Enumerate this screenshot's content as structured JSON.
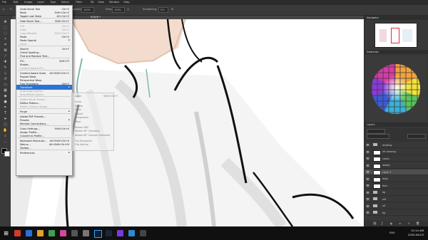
{
  "menubar": [
    "File",
    "Edit",
    "Image",
    "Layer",
    "Type",
    "Select",
    "Filter",
    "3D",
    "View",
    "Window",
    "Help"
  ],
  "options": {
    "size": "70",
    "mode_label": "Mode:",
    "mode": "Normal",
    "opacity_label": "Opacity:",
    "opacity": "100%",
    "flow_label": "Flow:",
    "flow": "100%",
    "smoothing_label": "Smoothing:",
    "smoothing": "0%"
  },
  "doc_tab": "RGB/8 *",
  "edit_menu": [
    {
      "label": "Undo Brush Tool",
      "shortcut": "Ctrl+Z",
      "state": "normal"
    },
    {
      "label": "Redo",
      "shortcut": "Shift+Ctrl+Z",
      "state": "normal"
    },
    {
      "label": "Toggle Last State",
      "shortcut": "Alt+Ctrl+Z",
      "state": "normal"
    },
    {
      "sep": true
    },
    {
      "label": "Fade Brush Tool...",
      "shortcut": "Shift+Ctrl+F",
      "state": "normal"
    },
    {
      "sep": true
    },
    {
      "label": "Cut",
      "shortcut": "Ctrl+X",
      "state": "disabled"
    },
    {
      "label": "Copy",
      "shortcut": "Ctrl+C",
      "state": "disabled"
    },
    {
      "label": "Copy Merged",
      "shortcut": "Shift+Ctrl+C",
      "state": "disabled"
    },
    {
      "label": "Paste",
      "shortcut": "Ctrl+V",
      "state": "normal"
    },
    {
      "label": "Paste Special",
      "submenu": true,
      "state": "normal"
    },
    {
      "label": "Clear",
      "state": "disabled"
    },
    {
      "sep": true
    },
    {
      "label": "Search",
      "shortcut": "Ctrl+F",
      "state": "normal"
    },
    {
      "label": "Check Spelling...",
      "state": "normal"
    },
    {
      "label": "Find and Replace Text...",
      "state": "normal"
    },
    {
      "sep": true
    },
    {
      "label": "Fill...",
      "shortcut": "Shift+F5",
      "state": "normal"
    },
    {
      "label": "Stroke...",
      "state": "normal"
    },
    {
      "label": "Content-Aware Fill...",
      "state": "disabled"
    },
    {
      "sep": true
    },
    {
      "label": "Content-Aware Scale",
      "shortcut": "Alt+Shift+Ctrl+C",
      "state": "normal"
    },
    {
      "label": "Puppet Warp",
      "state": "normal"
    },
    {
      "label": "Perspective Warp",
      "state": "normal"
    },
    {
      "label": "Free Transform",
      "shortcut": "Ctrl+T",
      "state": "normal"
    },
    {
      "label": "Transform",
      "submenu": true,
      "state": "highlighted"
    },
    {
      "label": "Auto-Align Layers...",
      "state": "disabled"
    },
    {
      "label": "Auto-Blend Layers...",
      "state": "disabled"
    },
    {
      "sep": true
    },
    {
      "label": "Define Brush Preset...",
      "state": "disabled"
    },
    {
      "label": "Define Pattern...",
      "state": "normal"
    },
    {
      "label": "Define Custom Shape...",
      "state": "disabled"
    },
    {
      "sep": true
    },
    {
      "label": "Purge",
      "submenu": true,
      "state": "normal"
    },
    {
      "sep": true
    },
    {
      "label": "Adobe PDF Presets...",
      "state": "normal"
    },
    {
      "label": "Presets",
      "submenu": true,
      "state": "normal"
    },
    {
      "label": "Remote Connections...",
      "state": "normal"
    },
    {
      "sep": true
    },
    {
      "label": "Color Settings...",
      "shortcut": "Shift+Ctrl+K",
      "state": "normal"
    },
    {
      "label": "Assign Profile...",
      "state": "normal"
    },
    {
      "label": "Convert to Profile...",
      "state": "normal"
    },
    {
      "sep": true
    },
    {
      "label": "Keyboard Shortcuts...",
      "shortcut": "Alt+Shift+Ctrl+K",
      "state": "normal"
    },
    {
      "label": "Menus...",
      "shortcut": "Alt+Shift+Ctrl+M",
      "state": "normal"
    },
    {
      "label": "Toolbar...",
      "state": "normal"
    },
    {
      "sep": true
    },
    {
      "label": "Preferences",
      "submenu": true,
      "state": "normal"
    }
  ],
  "transform_submenu": [
    {
      "label": "Again",
      "shortcut": "Shift+Ctrl+T"
    },
    {
      "label": "Scale"
    },
    {
      "label": "Rotate"
    },
    {
      "label": "Skew"
    },
    {
      "label": "Distort"
    },
    {
      "label": "Perspective"
    },
    {
      "label": "Warp"
    },
    {
      "label": "Rotate 180°"
    },
    {
      "label": "Rotate 90° Clockwise"
    },
    {
      "label": "Rotate 90° Counter Clockwise"
    },
    {
      "label": "Flip Horizontal"
    },
    {
      "label": "Flip Vertical"
    }
  ],
  "panels": {
    "navigator": "Navigator",
    "swatches": "Swatches",
    "layers": "Layers"
  },
  "layers": [
    {
      "name": "drawing",
      "type": "group"
    },
    {
      "name": "ref drawing",
      "type": "layer"
    },
    {
      "name": "colors",
      "type": "layer"
    },
    {
      "name": "details",
      "type": "layer"
    },
    {
      "name": "Layer 1",
      "type": "layer",
      "selected": true
    },
    {
      "name": "body",
      "type": "layer"
    },
    {
      "name": "face",
      "type": "layer"
    },
    {
      "name": "bg",
      "type": "group"
    },
    {
      "name": "old",
      "type": "group"
    },
    {
      "name": "ref",
      "type": "group"
    },
    {
      "name": "bg",
      "type": "group"
    }
  ],
  "taskbar": {
    "time": "10:14 AM",
    "date": "2020-06-03",
    "lang": "ENG"
  },
  "colors": {
    "accent": "#2a74d6",
    "menu_bg": "#f0f0f0",
    "panel_bg": "#383838",
    "canvas": "#ffffff"
  }
}
